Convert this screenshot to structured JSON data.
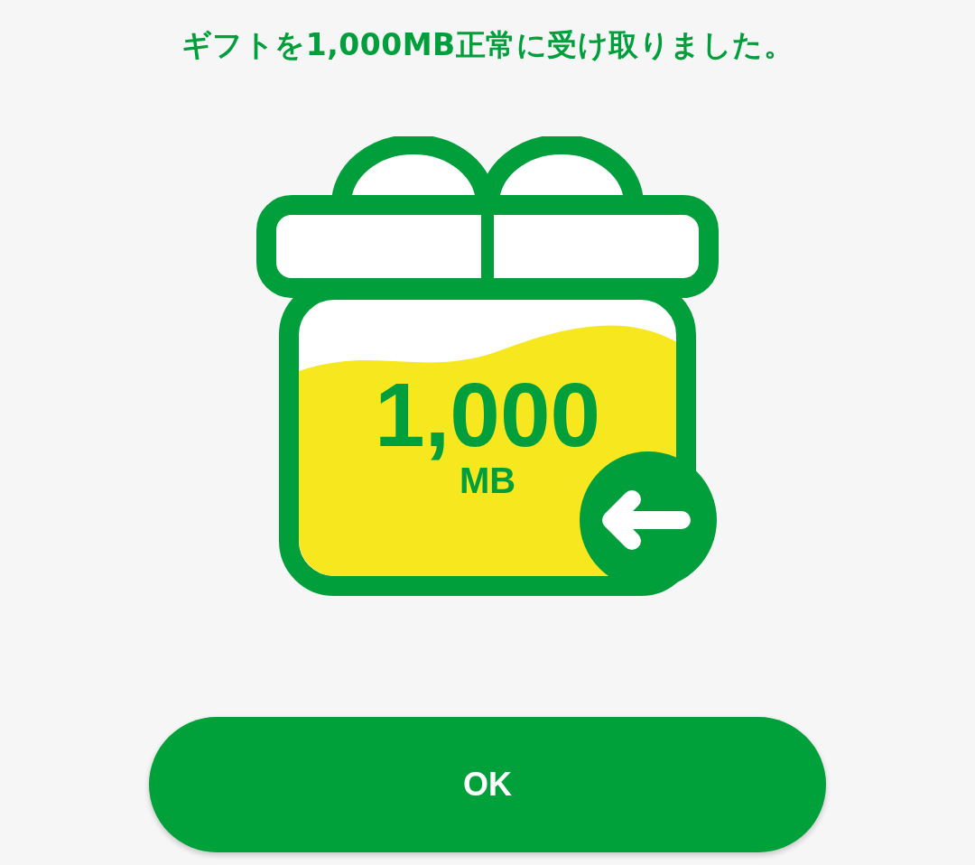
{
  "message": "ギフトを1,000MB正常に受け取りました。",
  "gift": {
    "amount": "1,000",
    "unit": "MB"
  },
  "button": {
    "label": "OK"
  }
}
